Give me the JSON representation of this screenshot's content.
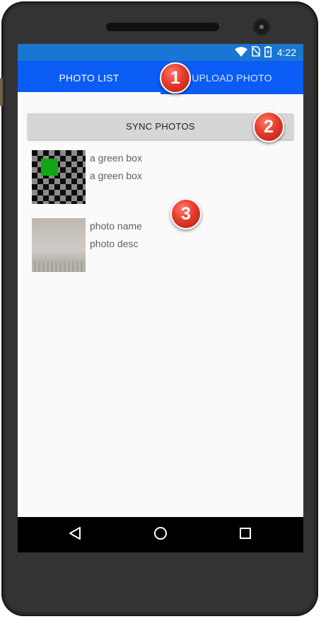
{
  "status_bar": {
    "time": "4:22",
    "icons": [
      "wifi-icon",
      "no-sim-icon",
      "battery-charging-icon"
    ]
  },
  "tabs": [
    {
      "label": "PHOTO LIST",
      "selected": true
    },
    {
      "label": "UPLOAD PHOTO",
      "selected": false
    }
  ],
  "sync_button": {
    "label": "SYNC PHOTOS"
  },
  "photos": [
    {
      "title": "a green box",
      "description": "a green box",
      "thumbnail": "checkerboard-with-green-square"
    },
    {
      "title": "photo name",
      "description": "photo desc",
      "thumbnail": "wall-photo"
    }
  ],
  "nav_bar": {
    "icons": [
      "back-icon",
      "home-icon",
      "recents-icon"
    ]
  },
  "callouts": [
    {
      "number": "1"
    },
    {
      "number": "2"
    },
    {
      "number": "3"
    }
  ],
  "colors": {
    "status_bar": "#1976d2",
    "tab_bar": "#0a5cf5",
    "callout": "#e53b2c",
    "green_box": "#11a614"
  }
}
